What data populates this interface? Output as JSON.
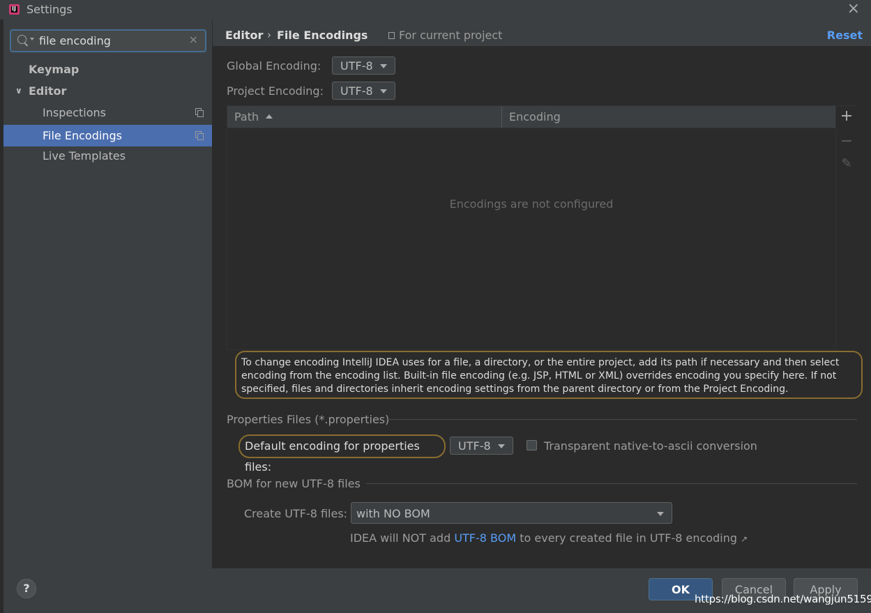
{
  "window": {
    "title": "Settings",
    "close_glyph": "×"
  },
  "search": {
    "value": "file encoding",
    "clear_glyph": "×"
  },
  "sidebar": {
    "items": [
      {
        "label": "Keymap"
      },
      {
        "label": "Editor",
        "expanded_glyph": "∨"
      },
      {
        "label": "Inspections"
      },
      {
        "label": "File Encodings"
      },
      {
        "label": "Live Templates"
      }
    ]
  },
  "header": {
    "breadcrumb_1": "Editor",
    "breadcrumb_sep": "›",
    "breadcrumb_2": "File Encodings",
    "scope": "For current project",
    "reset": "Reset"
  },
  "encoding": {
    "global_label": "Global Encoding:",
    "global_value": "UTF-8",
    "project_label": "Project Encoding:",
    "project_value": "UTF-8"
  },
  "table": {
    "columns": [
      "Path",
      "Encoding"
    ],
    "empty_text": "Encodings are not configured",
    "add_glyph": "+",
    "remove_glyph": "−",
    "edit_glyph": "✎"
  },
  "info": "To change encoding IntelliJ IDEA uses for a file, a directory, or the entire project, add its path if necessary and then select encoding from the encoding list. Built-in file encoding (e.g. JSP, HTML or XML) overrides encoding you specify here. If not specified, files and directories inherit encoding settings from the parent directory or from the Project Encoding.",
  "properties": {
    "section_title": "Properties Files (*.properties)",
    "default_label": "Default encoding for properties files:",
    "default_value": "UTF-8",
    "transparent_label": "Transparent native-to-ascii conversion",
    "transparent_checked": false
  },
  "bom": {
    "section_title": "BOM for new UTF-8 files",
    "create_label": "Create UTF-8 files:",
    "create_value": "with NO BOM",
    "hint_prefix": "IDEA will NOT add ",
    "hint_link": "UTF-8 BOM",
    "hint_suffix": " to every created file in UTF-8 encoding ",
    "hint_arrow": "↗"
  },
  "footer": {
    "help": "?",
    "ok": "OK",
    "cancel": "Cancel",
    "apply": "Apply"
  },
  "watermark": "https://blog.csdn.net/wangjun5159",
  "colors": {
    "accent": "#4b6eaf",
    "link": "#589df6",
    "highlight_border": "#8a6d2f",
    "background": "#2b2b2b",
    "panel": "#3c3f41"
  }
}
